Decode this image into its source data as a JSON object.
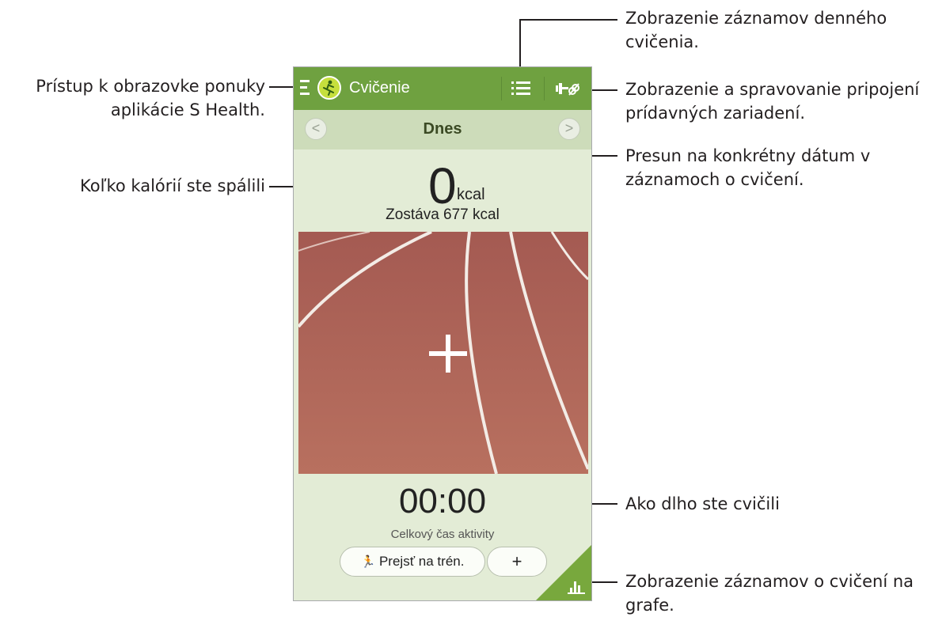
{
  "app": {
    "title": "Cvičenie",
    "date_label": "Dnes",
    "prev_arrow": "<",
    "next_arrow": ">"
  },
  "calories": {
    "value": "0",
    "unit": "kcal",
    "remaining": "Zostáva 677 kcal"
  },
  "timer": {
    "value": "00:00",
    "label": "Celkový čas aktivity"
  },
  "buttons": {
    "train": "Prejsť na trén.",
    "train_icon": "🏃",
    "add": "+"
  },
  "callouts": {
    "menu": [
      "Prístup k obrazovke ponuky",
      "aplikácie S Health."
    ],
    "calories": "Koľko kalórií ste spálili",
    "daily_records": [
      "Zobrazenie záznamov denného",
      "cvičenia."
    ],
    "devices": [
      "Zobrazenie a spravovanie pripojení",
      "prídavných zariadení."
    ],
    "date": [
      "Presun na konkrétny dátum v",
      "záznamoch o cvičení."
    ],
    "duration": "Ako dlho ste cvičili",
    "graph": [
      "Zobrazenie záznamov o cvičení na",
      "grafe."
    ]
  },
  "colors": {
    "topbar": "#6fa140",
    "background": "#e3ecd6",
    "datebar": "#cddcba",
    "track": "#b0655a",
    "accent": "#78a83d"
  },
  "icons": {
    "menu": "menu-icon",
    "logo": "exercise-logo-icon",
    "list": "list-icon",
    "devices": "accessory-device-icon",
    "graph": "bar-graph-icon",
    "add": "plus-icon"
  }
}
